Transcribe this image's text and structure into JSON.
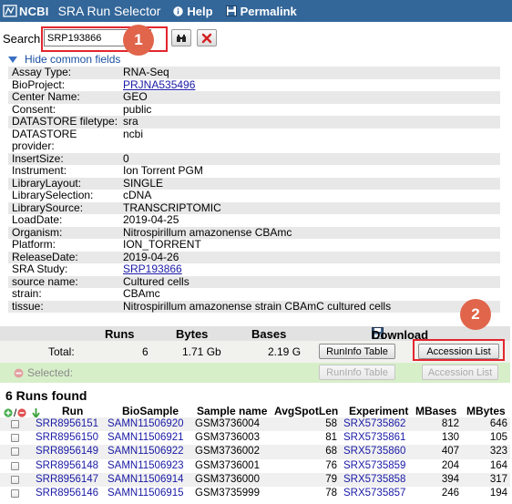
{
  "header": {
    "logo_text": "NCBI",
    "app_title": "SRA Run Selector",
    "help_label": "Help",
    "permalink_label": "Permalink"
  },
  "search": {
    "label": "Search",
    "value": "SRP193866"
  },
  "annotations": {
    "badge1": "1",
    "badge2": "2"
  },
  "common_fields": {
    "toggle_label": "Hide common fields",
    "rows": [
      {
        "name": "Assay Type:",
        "value": "RNA-Seq"
      },
      {
        "name": "BioProject:",
        "value": "PRJNA535496"
      },
      {
        "name": "Center Name:",
        "value": "GEO"
      },
      {
        "name": "Consent:",
        "value": "public"
      },
      {
        "name": "DATASTORE filetype:",
        "value": "sra"
      },
      {
        "name": "DATASTORE provider:",
        "value": "ncbi"
      },
      {
        "name": "InsertSize:",
        "value": "0"
      },
      {
        "name": "Instrument:",
        "value": "Ion Torrent PGM"
      },
      {
        "name": "LibraryLayout:",
        "value": "SINGLE"
      },
      {
        "name": "LibrarySelection:",
        "value": "cDNA"
      },
      {
        "name": "LibrarySource:",
        "value": "TRANSCRIPTOMIC"
      },
      {
        "name": "LoadDate:",
        "value": "2019-04-25"
      },
      {
        "name": "Organism:",
        "value": "Nitrospirillum amazonense CBAmc"
      },
      {
        "name": "Platform:",
        "value": "ION_TORRENT"
      },
      {
        "name": "ReleaseDate:",
        "value": "2019-04-26"
      },
      {
        "name": "SRA Study:",
        "value": "SRP193866"
      },
      {
        "name": "source name:",
        "value": "Cultured cells"
      },
      {
        "name": "strain:",
        "value": "CBAmc"
      },
      {
        "name": "tissue:",
        "value": "Nitrospirillum amazonense strain CBAmC cultured cells"
      }
    ]
  },
  "summary": {
    "col_runs": "Runs",
    "col_bytes": "Bytes",
    "col_bases": "Bases",
    "col_download": "Download",
    "total_label": "Total:",
    "total_runs": "6",
    "total_bytes": "1.71 Gb",
    "total_bases": "2.19 G",
    "selected_label": "Selected:",
    "runinfo_btn": "RunInfo Table",
    "accession_btn": "Accession List"
  },
  "runs": {
    "found_label": "6 Runs found",
    "headers": [
      "Run",
      "BioSample",
      "Sample name",
      "AvgSpotLen",
      "Experiment",
      "MBases",
      "MBytes"
    ],
    "rows": [
      [
        "SRR8956151",
        "SAMN11506920",
        "GSM3736004",
        "58",
        "SRX5735862",
        "812",
        "646"
      ],
      [
        "SRR8956150",
        "SAMN11506921",
        "GSM3736003",
        "81",
        "SRX5735861",
        "130",
        "105"
      ],
      [
        "SRR8956149",
        "SAMN11506922",
        "GSM3736002",
        "68",
        "SRX5735860",
        "407",
        "323"
      ],
      [
        "SRR8956148",
        "SAMN11506923",
        "GSM3736001",
        "76",
        "SRX5735859",
        "204",
        "164"
      ],
      [
        "SRR8956147",
        "SAMN11506914",
        "GSM3736000",
        "79",
        "SRX5735858",
        "394",
        "317"
      ],
      [
        "SRR8956146",
        "SAMN11506915",
        "GSM3735999",
        "78",
        "SRX5735857",
        "246",
        "194"
      ]
    ]
  },
  "colors": {
    "header_bg": "#336699",
    "highlight": "#e3262f",
    "badge": "#e0654b",
    "link": "#1a1aa6",
    "selected_bg": "#d7efc9"
  }
}
